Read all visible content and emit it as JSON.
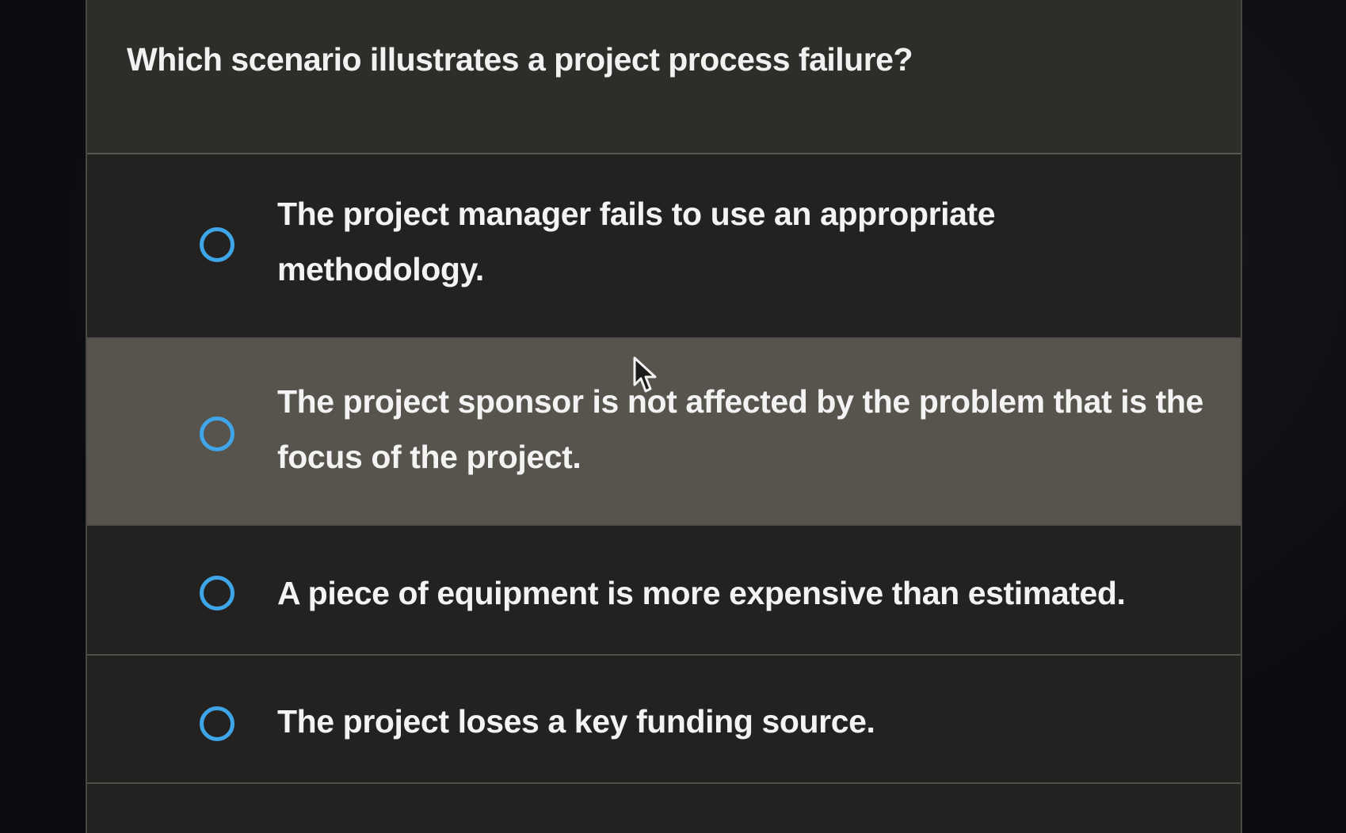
{
  "question": {
    "text": "Which scenario illustrates a project process failure?"
  },
  "options": [
    {
      "label": "The project manager fails to use an appropriate methodology.",
      "selected": false
    },
    {
      "label": "The project sponsor is not affected by the problem that is the focus of the project.",
      "selected": false
    },
    {
      "label": "A piece of equipment is more expensive than estimated.",
      "selected": false
    },
    {
      "label": "The project loses a key funding source.",
      "selected": false
    }
  ],
  "colors": {
    "radio_accent": "#3ea6e8",
    "panel_bg": "#2b2926",
    "hover_bg": "#57534d"
  },
  "icons": {
    "radio": "radio-unchecked-icon",
    "cursor": "mouse-pointer-icon"
  }
}
